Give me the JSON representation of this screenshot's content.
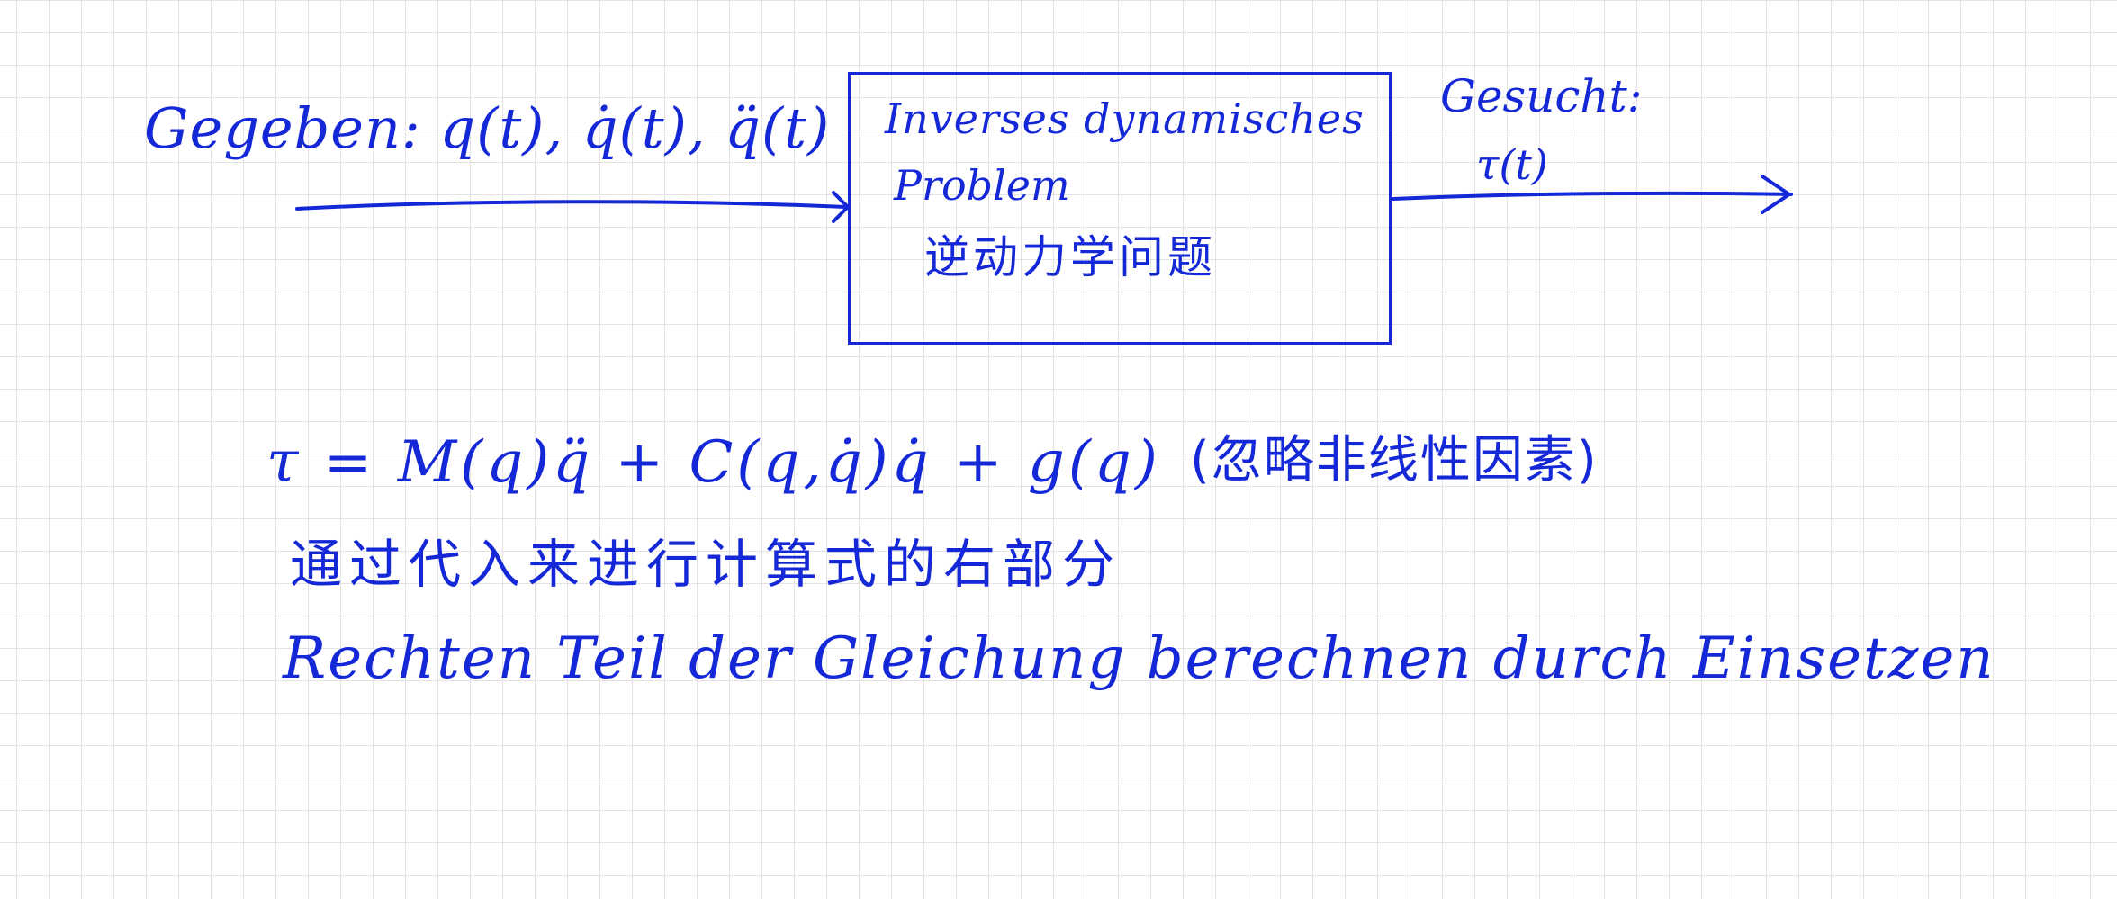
{
  "input": {
    "label": "Gegeben: q(t), q̇(t), q̈(t)"
  },
  "process_box": {
    "line1": "Inverses dynamisches",
    "line2": "Problem",
    "line3": "逆动力学问题"
  },
  "output": {
    "label": "Gesucht:",
    "value": "τ(t)"
  },
  "equation": {
    "formula": "τ = M(q)q̈ + C(q,q̇)q̇ + g(q)",
    "note": "(忽略非线性因素)"
  },
  "explanation": {
    "zh": "通过代入来进行计算式的右部分",
    "de": "Rechten Teil der Gleichung berechnen durch Einsetzen"
  },
  "colors": {
    "ink": "#1428d8",
    "grid": "#e3e3e3",
    "paper": "#ffffff"
  },
  "icons": {
    "input_arrow": "arrow-right",
    "output_arrow": "arrow-right"
  }
}
